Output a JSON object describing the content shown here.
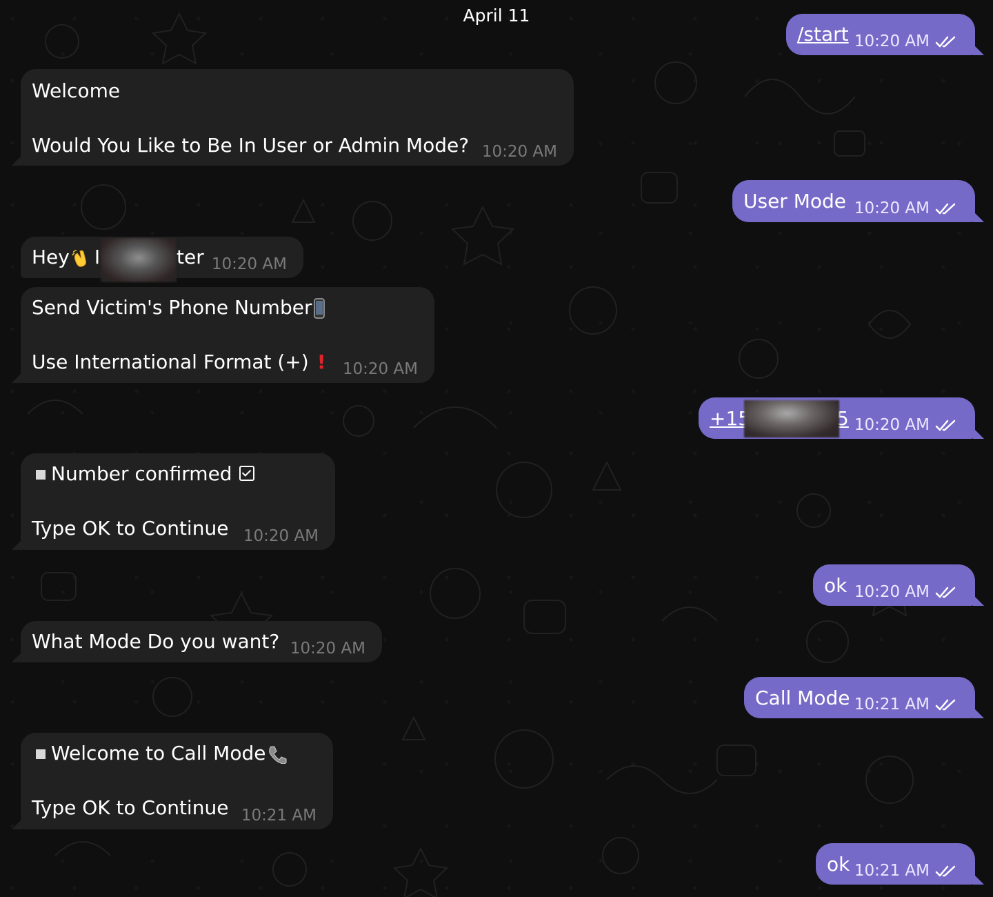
{
  "chat": {
    "date_separator": "April 11",
    "colors": {
      "background": "#0f0f0f",
      "incoming_bubble": "#212121",
      "outgoing_bubble": "#766ac8",
      "incoming_time": "#7a7a7a",
      "outgoing_time": "#ebe8ff"
    },
    "messages": [
      {
        "direction": "outgoing",
        "text": "/start",
        "link": true,
        "time": "10:20 AM",
        "status_icon": "double-check-icon"
      },
      {
        "direction": "incoming",
        "lines": [
          "Welcome",
          "Would You Like to Be In User or Admin Mode?"
        ],
        "time": "10:20 AM"
      },
      {
        "direction": "outgoing",
        "text": "User Mode",
        "time": "10:20 AM",
        "status_icon": "double-check-icon"
      },
      {
        "direction": "incoming",
        "text_before": "Hey",
        "emoji": "waving-hand-icon",
        "text_visible_start": "I",
        "text_visible_end": "ter",
        "time": "10:20 AM"
      },
      {
        "direction": "incoming",
        "lines": [
          "Send Victim's Phone Number",
          "Use International Format (+)"
        ],
        "icons": [
          "mobile-phone-icon",
          "exclamation-icon"
        ],
        "time": "10:20 AM"
      },
      {
        "direction": "outgoing",
        "text_start": "+15",
        "text_end": "5",
        "link": true,
        "time": "10:20 AM",
        "status_icon": "double-check-icon"
      },
      {
        "direction": "incoming",
        "lines": [
          "Number confirmed",
          "Type OK to Continue"
        ],
        "icons": [
          "square-icon",
          "checkbox-icon"
        ],
        "time": "10:20 AM"
      },
      {
        "direction": "outgoing",
        "text": "ok",
        "time": "10:20 AM",
        "status_icon": "double-check-icon"
      },
      {
        "direction": "incoming",
        "text": "What Mode Do you want?",
        "time": "10:20 AM"
      },
      {
        "direction": "outgoing",
        "text": "Call Mode",
        "time": "10:21 AM",
        "status_icon": "double-check-icon"
      },
      {
        "direction": "incoming",
        "lines": [
          "Welcome to Call Mode",
          "Type OK to Continue"
        ],
        "icons": [
          "square-icon",
          "telephone-icon"
        ],
        "time": "10:21 AM"
      },
      {
        "direction": "outgoing",
        "text": "ok",
        "time": "10:21 AM",
        "status_icon": "double-check-icon"
      }
    ]
  }
}
